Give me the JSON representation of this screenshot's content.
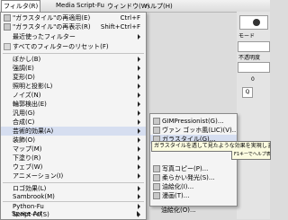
{
  "menubar": {
    "items": [
      {
        "label": "フィルタ(R)"
      },
      {
        "label": "Media"
      },
      {
        "label": "Script-Fu"
      },
      {
        "label": "ウィンドウ(W)"
      },
      {
        "label": "ヘルプ(H)"
      }
    ]
  },
  "filters_menu": {
    "items": [
      {
        "label": "\"ガラスタイル\"の再適用(E)",
        "shortcut": "Ctrl+F"
      },
      {
        "label": "\"ガラスタイル\"の再表示(R)",
        "shortcut": "Shift+Ctrl+F"
      },
      {
        "label": "最近使ったフィルター"
      },
      {
        "label": "すべてのフィルターのリセット(F)"
      },
      {
        "label": "ぼかし(B)"
      },
      {
        "label": "強調(E)"
      },
      {
        "label": "変形(D)"
      },
      {
        "label": "照明と投影(L)"
      },
      {
        "label": "ノイズ(N)"
      },
      {
        "label": "輪郭検出(E)"
      },
      {
        "label": "汎用(G)"
      },
      {
        "label": "合成(C)"
      },
      {
        "label": "芸術的効果(A)"
      },
      {
        "label": "装飾(O)"
      },
      {
        "label": "マップ(M)"
      },
      {
        "label": "下塗り(R)"
      },
      {
        "label": "ウェブ(W)"
      },
      {
        "label": "アニメーション(I)"
      },
      {
        "label": "ロゴ効果(L)"
      },
      {
        "label": "Sambrook(M)"
      },
      {
        "label": "Python-Fu"
      },
      {
        "label": "Script-Fu(S)"
      },
      {
        "label": "Space Art"
      }
    ]
  },
  "artistic_submenu": {
    "items": [
      {
        "label": "GIMPressionist(G)..."
      },
      {
        "label": "ヴァン ゴッホ風(LIC)(V)..."
      },
      {
        "label": "ガラスタイル(G)..."
      },
      {
        "label": "写真コピー(P)..."
      },
      {
        "label": "柔らかい発光(S)..."
      },
      {
        "label": "油絵化(I)..."
      },
      {
        "label": "漫画(T)..."
      },
      {
        "label": "油絵化(O)..."
      }
    ]
  },
  "tooltip": {
    "text": "ガラスタイルを透して見たような効果を実現します",
    "hint": "F1キーでヘルプ表示"
  },
  "right_panel": {
    "mode_label": "モード",
    "opacity_label": "不透明度",
    "value": "0",
    "letter": "Q"
  }
}
